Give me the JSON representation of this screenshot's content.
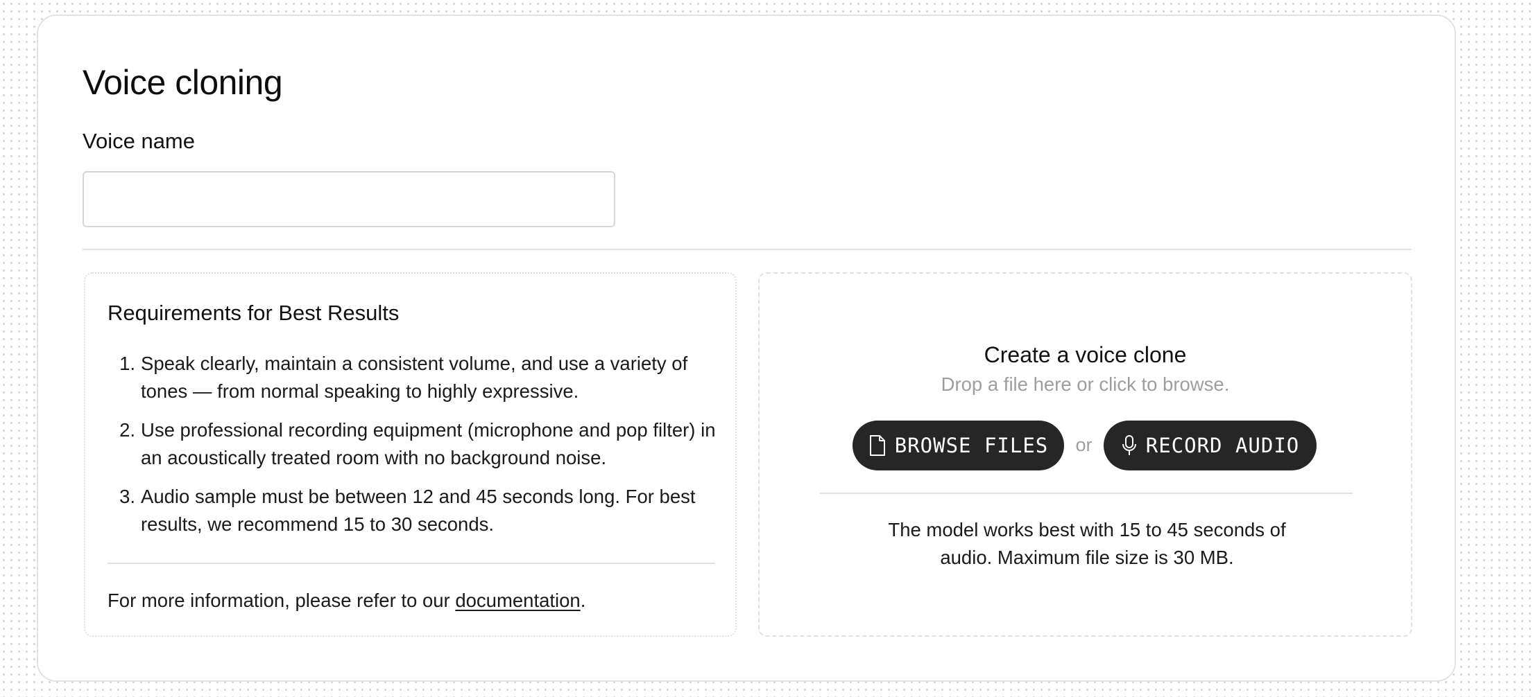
{
  "page": {
    "title": "Voice cloning"
  },
  "voice_name": {
    "label": "Voice name",
    "value": "",
    "placeholder": ""
  },
  "requirements": {
    "title": "Requirements for Best Results",
    "items": [
      {
        "number": "1.",
        "text": "Speak clearly, maintain a consistent volume, and use a variety of tones — from normal speaking to highly expressive."
      },
      {
        "number": "2.",
        "text": "Use professional recording equipment (microphone and pop filter) in an acoustically treated room with no background noise."
      },
      {
        "number": "3.",
        "text": "Audio sample must be between 12 and 45 seconds long. For best results, we recommend 15 to 30 seconds."
      }
    ],
    "footer_prefix": "For more information, please refer to our ",
    "footer_link": "documentation",
    "footer_suffix": "."
  },
  "upload": {
    "title": "Create a voice clone",
    "subtitle": "Drop a file here or click to browse.",
    "browse_label": "BROWSE FILES",
    "browse_icon": "file-icon",
    "or_text": "or",
    "record_label": "RECORD AUDIO",
    "record_icon": "microphone-icon",
    "note": "The model works best with 15 to 45 seconds of audio. Maximum file size is 30 MB."
  },
  "colors": {
    "button_bg": "#262626",
    "muted_text": "#9e9e9e",
    "border": "#e0e0e0"
  }
}
